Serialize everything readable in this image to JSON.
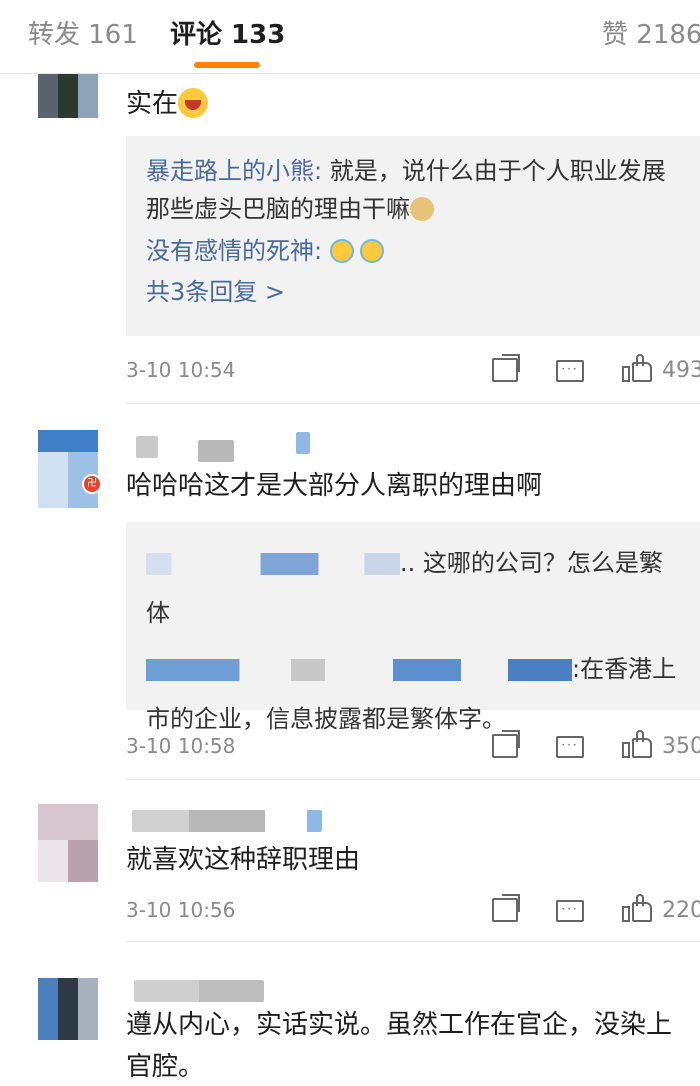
{
  "tabs": {
    "repost": "转发 161",
    "comments": "评论 133",
    "likes": "赞 2186",
    "active_color": "#ff8200"
  },
  "comments": [
    {
      "text": "实在",
      "emoji": "grinning-face",
      "replies": [
        {
          "user": "暴走路上的小熊:",
          "text": " 就是，说什么由于个人职业发展那些虚头巴脑的理由干嘛"
        },
        {
          "user": "没有感情的死神:",
          "text": ""
        }
      ],
      "more": "共3条回复 >",
      "time": "3-10 10:54",
      "likes": "493"
    },
    {
      "text": "哈哈哈这才是大部分人离职的理由啊",
      "replies": [
        {
          "user": "",
          "text": ".. 这哪的公司？怎么是繁体"
        },
        {
          "user": "",
          "text": ":在香港上市的企业，信息披露都是繁体字。"
        }
      ],
      "time": "3-10 10:58",
      "likes": "350"
    },
    {
      "text": "就喜欢这种辞职理由",
      "time": "3-10 10:56",
      "likes": "220"
    },
    {
      "text": "遵从内心，实话实说。虽然工作在官企，没染上官腔。"
    }
  ],
  "colors": {
    "username": "#4a6a9a",
    "reply_bg": "#f2f2f2",
    "meta": "#8a8a8a"
  }
}
